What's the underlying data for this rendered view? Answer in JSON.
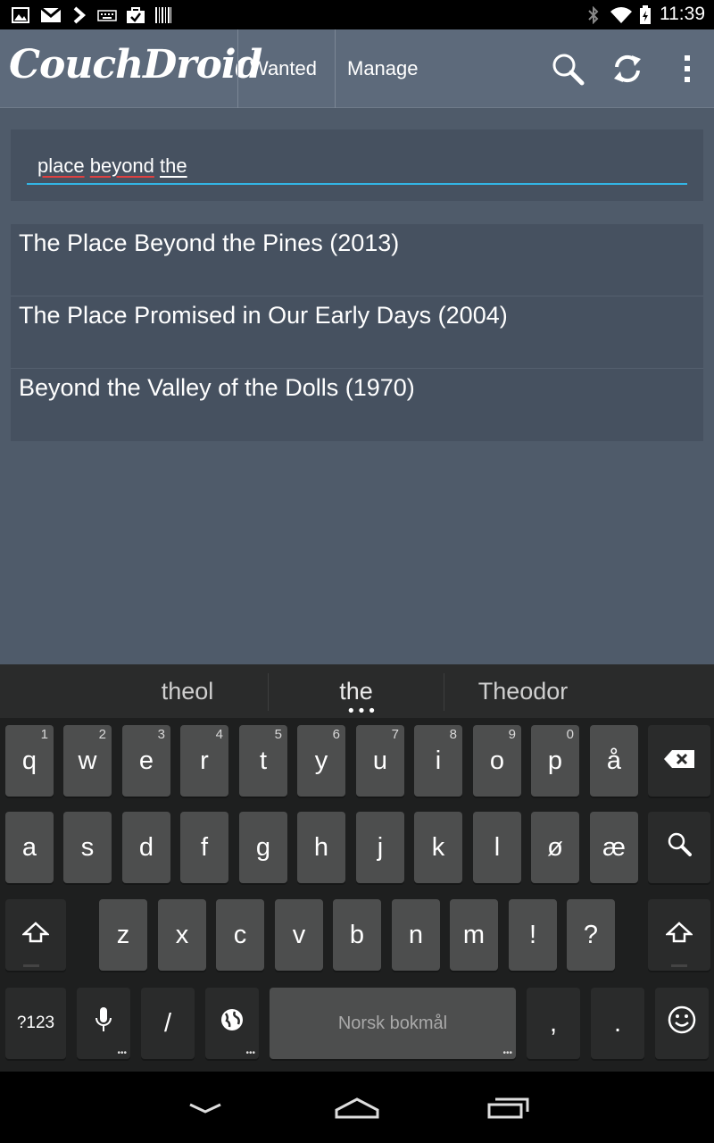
{
  "status_bar": {
    "time": "11:39",
    "left_icons": [
      "image-icon",
      "gmail-icon",
      "chevron-icon",
      "keyboard-icon",
      "bag-check-icon",
      "barcode-icon"
    ],
    "right_icons": [
      "bluetooth-icon",
      "wifi-icon",
      "battery-icon"
    ]
  },
  "action_bar": {
    "app_name": "CouchDroid",
    "tabs": [
      "Wanted",
      "Manage"
    ],
    "actions": [
      "search-icon",
      "refresh-icon",
      "overflow-menu-icon"
    ]
  },
  "search": {
    "words": [
      {
        "text": "place",
        "misspelled": true
      },
      {
        "text": "beyond",
        "misspelled": true
      },
      {
        "text": "the",
        "misspelled": false
      }
    ]
  },
  "results": [
    {
      "title": "The Place Beyond the Pines (2013)"
    },
    {
      "title": "The Place Promised in Our Early Days (2004)"
    },
    {
      "title": "Beyond the Valley of the Dolls (1970)"
    }
  ],
  "keyboard": {
    "suggestions": [
      "theol",
      "the",
      "Theodor"
    ],
    "suggestion_dots": "•••",
    "row1": [
      {
        "label": "q",
        "hint": "1"
      },
      {
        "label": "w",
        "hint": "2"
      },
      {
        "label": "e",
        "hint": "3"
      },
      {
        "label": "r",
        "hint": "4"
      },
      {
        "label": "t",
        "hint": "5"
      },
      {
        "label": "y",
        "hint": "6"
      },
      {
        "label": "u",
        "hint": "7"
      },
      {
        "label": "i",
        "hint": "8"
      },
      {
        "label": "o",
        "hint": "9"
      },
      {
        "label": "p",
        "hint": "0"
      },
      {
        "label": "å",
        "hint": ""
      }
    ],
    "row2": [
      "a",
      "s",
      "d",
      "f",
      "g",
      "h",
      "j",
      "k",
      "l",
      "ø",
      "æ"
    ],
    "row3": [
      "z",
      "x",
      "c",
      "v",
      "b",
      "n",
      "m",
      "!",
      "?"
    ],
    "symbols_label": "?123",
    "slash_label": "/",
    "space_label": "Norsk bokmål",
    "comma_label": ",",
    "period_label": "."
  },
  "nav_bar": {
    "buttons": [
      "back-icon",
      "home-icon",
      "recents-icon"
    ]
  }
}
